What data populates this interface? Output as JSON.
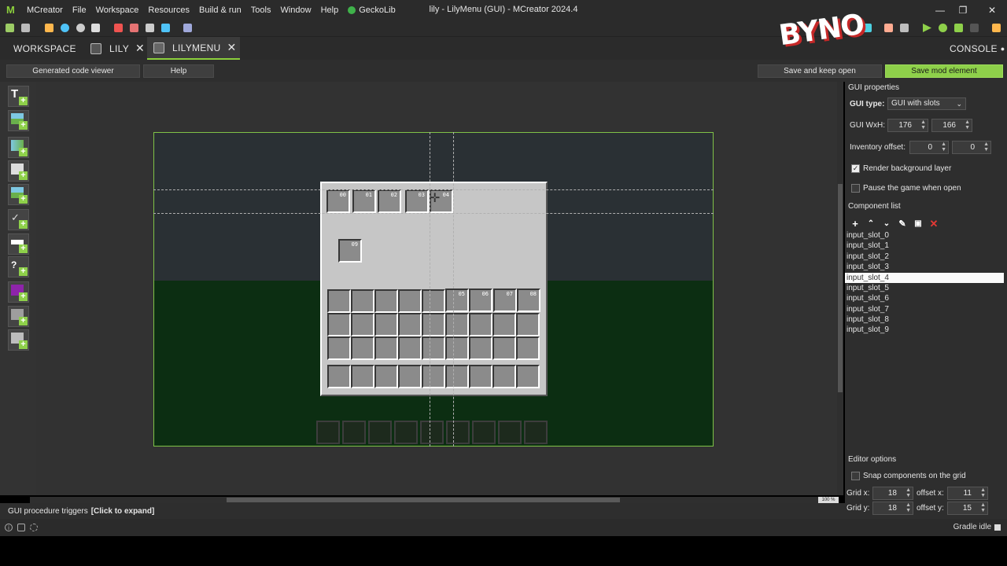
{
  "menubar": {
    "app_name": "MCreator",
    "items": [
      "File",
      "Workspace",
      "Resources",
      "Build & run",
      "Tools",
      "Window",
      "Help"
    ],
    "plugin": "GeckoLib"
  },
  "window_title": "lily - LilyMenu (GUI) - MCreator 2024.4",
  "tabs": {
    "workspace": "WORKSPACE",
    "lily": "LILY",
    "lilymenu": "LILYMENU",
    "console": "CONSOLE"
  },
  "editor_bar": {
    "code_viewer": "Generated code viewer",
    "help": "Help",
    "save_keep_open": "Save and keep open",
    "save_mod_element": "Save mod element"
  },
  "watermark": "BYNO",
  "gui": {
    "top_slots": [
      "00",
      "01",
      "02",
      "03",
      "04"
    ],
    "output_slot": "09",
    "right_slots": [
      "05",
      "06",
      "07",
      "08"
    ]
  },
  "zoom": "100 %",
  "triggers": {
    "label": "GUI procedure triggers",
    "action": "[Click to expand]"
  },
  "status": {
    "gradle": "Gradle idle"
  },
  "properties": {
    "section_title": "GUI properties",
    "gui_type_label": "GUI type:",
    "gui_type_value": "GUI with slots",
    "wxh_label": "GUI WxH:",
    "width": "176",
    "height": "166",
    "inv_offset_label": "Inventory offset:",
    "inv_offset_x": "0",
    "inv_offset_y": "0",
    "render_bg_label": "Render background layer",
    "render_bg_checked": true,
    "pause_label": "Pause the game when open",
    "pause_checked": false,
    "component_list_title": "Component list",
    "components": [
      "input_slot_0",
      "input_slot_1",
      "input_slot_2",
      "input_slot_3",
      "input_slot_4",
      "input_slot_5",
      "input_slot_6",
      "input_slot_7",
      "input_slot_8",
      "input_slot_9"
    ],
    "selected_component": "input_slot_4"
  },
  "editor_options": {
    "title": "Editor options",
    "snap_label": "Snap components on the grid",
    "grid_x_label": "Grid x:",
    "grid_x": "18",
    "offset_x_label": "offset x:",
    "offset_x": "11",
    "grid_y_label": "Grid y:",
    "grid_y": "18",
    "offset_y_label": "offset y:",
    "offset_y": "15"
  },
  "colors": {
    "accent_green": "#8ed04a",
    "panel": "#2e2e2e",
    "delete_red": "#e53935"
  }
}
